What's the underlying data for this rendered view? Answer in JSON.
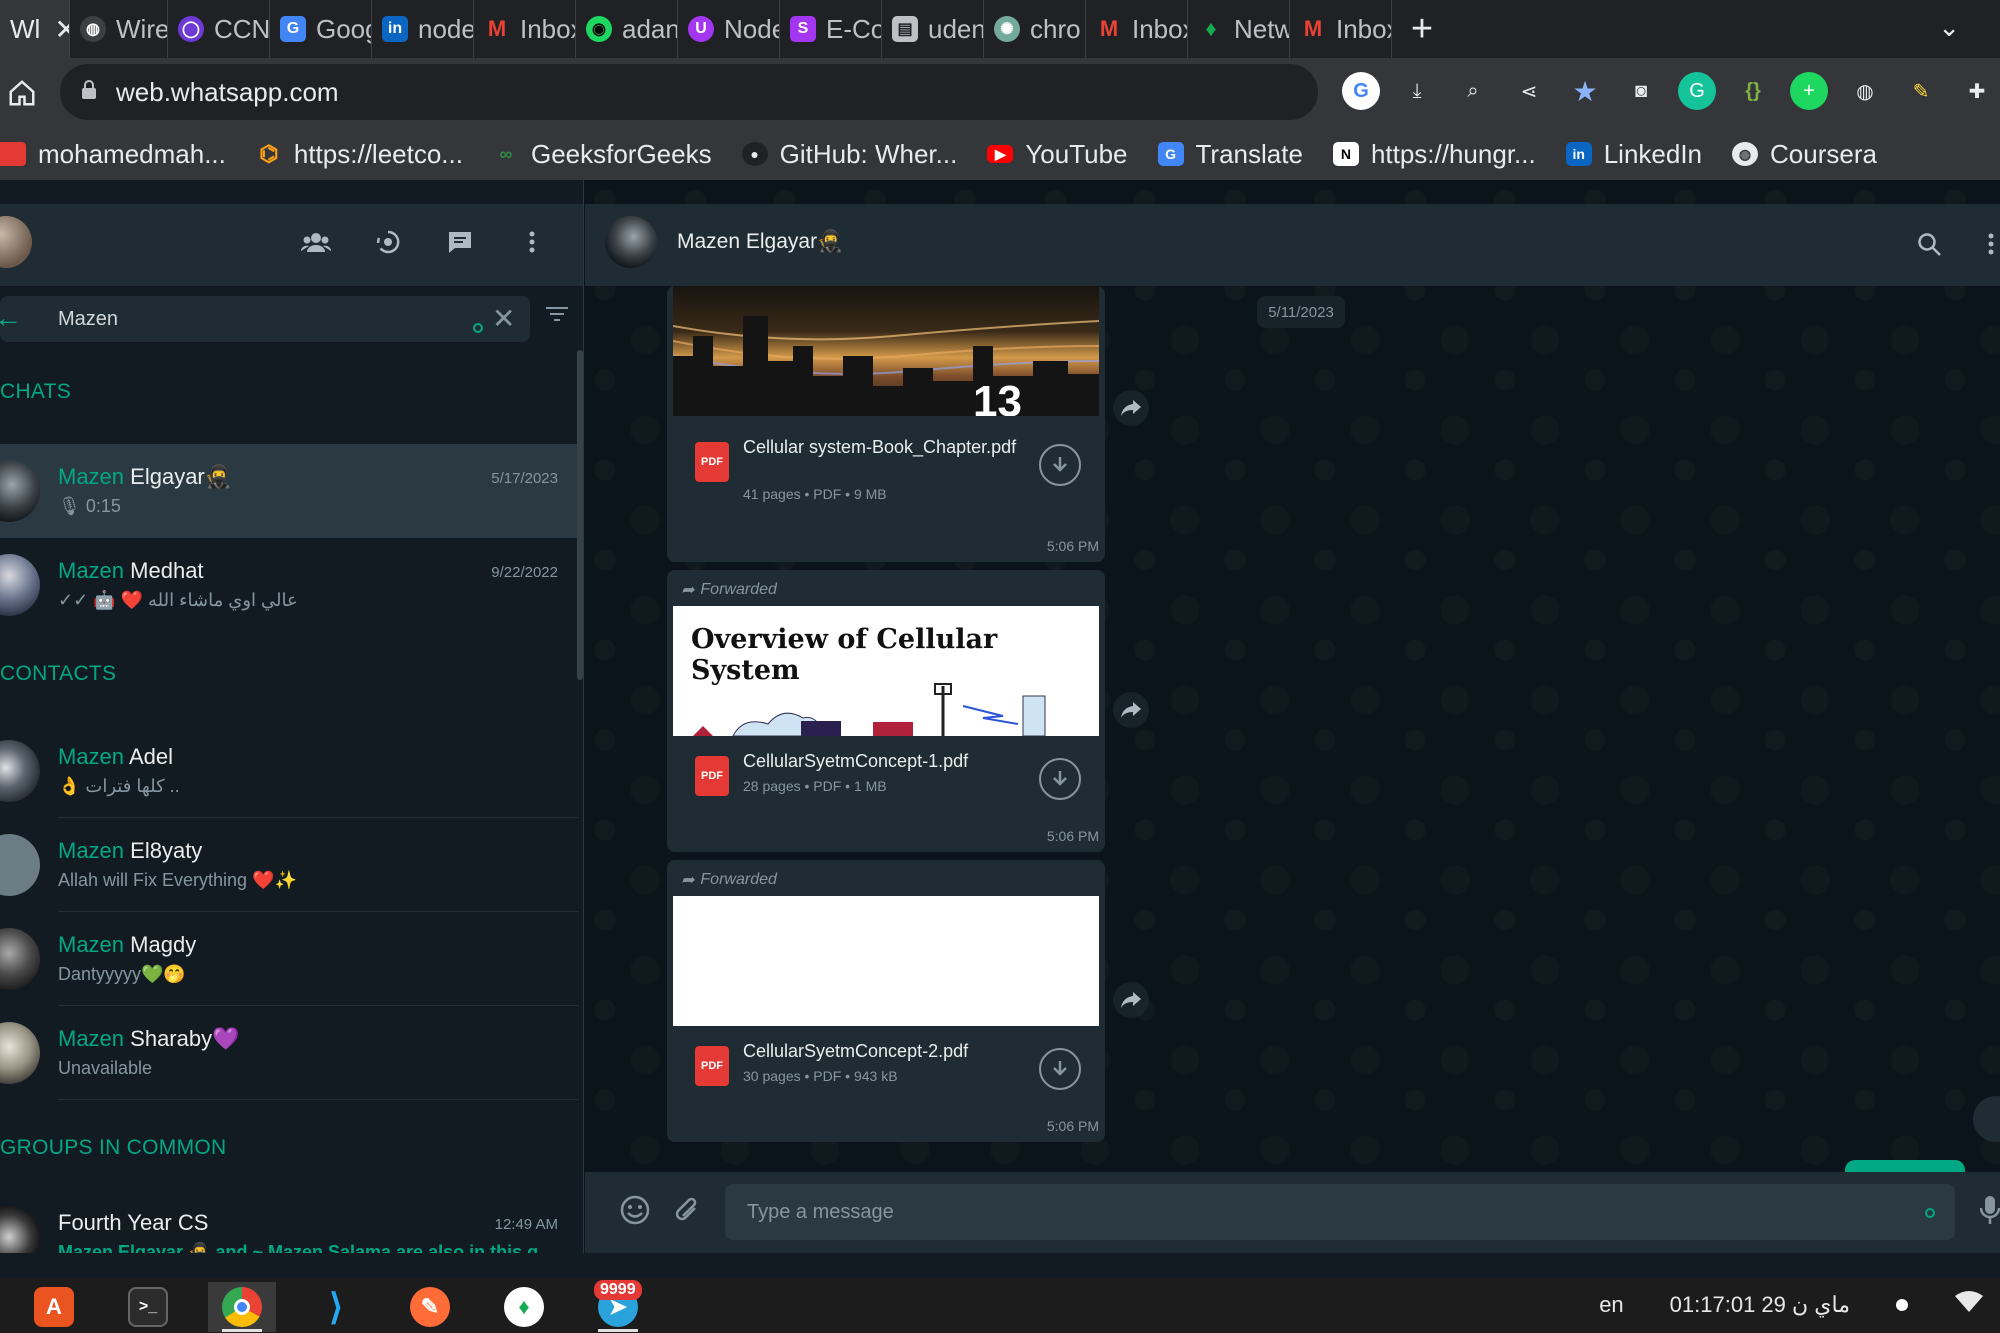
{
  "browser": {
    "tabs": [
      {
        "label": "Wl",
        "icon": "whatsapp",
        "color": "#25d366",
        "active": true
      },
      {
        "label": "Wirel",
        "icon": "globe",
        "color": "#bdc1c6"
      },
      {
        "label": "CCNA",
        "icon": "circle",
        "color": "#6e3ad6"
      },
      {
        "label": "Goog",
        "icon": "translate",
        "color": "#4285f4"
      },
      {
        "label": "node",
        "icon": "linkedin",
        "color": "#0a66c2"
      },
      {
        "label": "Inbox",
        "icon": "gmail",
        "color": "#ea4335"
      },
      {
        "label": "adan",
        "icon": "spotify",
        "color": "#1ed760"
      },
      {
        "label": "Node",
        "icon": "udemy",
        "color": "#a435f0"
      },
      {
        "label": "E-Co",
        "icon": "s-app",
        "color": "#a435f0"
      },
      {
        "label": "uden",
        "icon": "doc",
        "color": "#bdc1c6"
      },
      {
        "label": "chro",
        "icon": "openai",
        "color": "#74aa9c"
      },
      {
        "label": "Inbox",
        "icon": "gmail",
        "color": "#ea4335"
      },
      {
        "label": "Netw",
        "icon": "leaf",
        "color": "#13aa52"
      },
      {
        "label": "Inbox",
        "icon": "gmail",
        "color": "#ea4335"
      }
    ],
    "url": "web.whatsapp.com",
    "bookmarks": [
      {
        "label": "mohamedmah...",
        "icon": "red",
        "color": "#e53935"
      },
      {
        "label": "https://leetco...",
        "icon": "leetcode",
        "color": "#ffa116"
      },
      {
        "label": "GeeksforGeeks",
        "icon": "gfg",
        "color": "#2f8d46"
      },
      {
        "label": "GitHub: Wher...",
        "icon": "github",
        "color": "#333333"
      },
      {
        "label": "YouTube",
        "icon": "youtube",
        "color": "#ff0000"
      },
      {
        "label": "Translate",
        "icon": "translate",
        "color": "#4285f4"
      },
      {
        "label": "https://hungr...",
        "icon": "notion",
        "color": "#ffffff"
      },
      {
        "label": "LinkedIn",
        "icon": "linkedin",
        "color": "#0a66c2"
      },
      {
        "label": "Coursera",
        "icon": "globe",
        "color": "#e8eaed"
      }
    ]
  },
  "sidebar": {
    "search_value": "Mazen",
    "sections": {
      "chats": "CHATS",
      "contacts": "CONTACTS",
      "groups": "GROUPS IN COMMON"
    },
    "chats": [
      {
        "highlight": "Mazen",
        "rest": " Elgayar🥷",
        "time": "5/17/2023",
        "sub": "🎙 0:15",
        "selected": true
      },
      {
        "highlight": "Mazen",
        "rest": " Medhat",
        "time": "9/22/2022",
        "sub": "✓✓ 🤖 ❤️ عالي اوي ماشاء الله"
      }
    ],
    "contacts": [
      {
        "highlight": "Mazen",
        "rest": " Adel",
        "sub": "👌 كلها فترات .."
      },
      {
        "highlight": "Mazen",
        "rest": " El8yaty",
        "sub": "Allah will Fix Everything ❤️✨"
      },
      {
        "highlight": "Mazen",
        "rest": " Magdy",
        "sub": "Dantyyyyy💚🤭"
      },
      {
        "highlight": "Mazen",
        "rest": " Sharaby💜",
        "sub": "Unavailable"
      }
    ],
    "groups": [
      {
        "name": "Fourth Year CS",
        "time": "12:49 AM",
        "sub": "Mazen Elgayar 🥷 and ~ Mazen Salama are also in this g..."
      }
    ]
  },
  "conversation": {
    "contact_name": "Mazen Elgayar🥷",
    "date_chip": "5/11/2023",
    "forwarded_label": "Forwarded",
    "messages": [
      {
        "file": "Cellular system-Book_Chapter.pdf",
        "meta": "41 pages • PDF • 9 MB",
        "time": "5:06 PM",
        "forwarded": false,
        "thumb_text": ""
      },
      {
        "file": "CellularSyetmConcept-1.pdf",
        "meta": "28 pages • PDF • 1 MB",
        "time": "5:06 PM",
        "forwarded": true,
        "thumb_text": "Overview of Cellular System"
      },
      {
        "file": "CellularSyetmConcept-2.pdf",
        "meta": "30 pages • PDF • 943 kB",
        "time": "5:06 PM",
        "forwarded": true,
        "thumb_text": ""
      }
    ],
    "pdf_badge": "PDF",
    "composer_placeholder": "Type a message"
  },
  "taskbar": {
    "badge": "9999",
    "lang": "en",
    "clock": "01:17:01  29 ماي ن"
  },
  "colors": {
    "accent": "#00a884",
    "panel": "#202c33",
    "background": "#111b21"
  }
}
